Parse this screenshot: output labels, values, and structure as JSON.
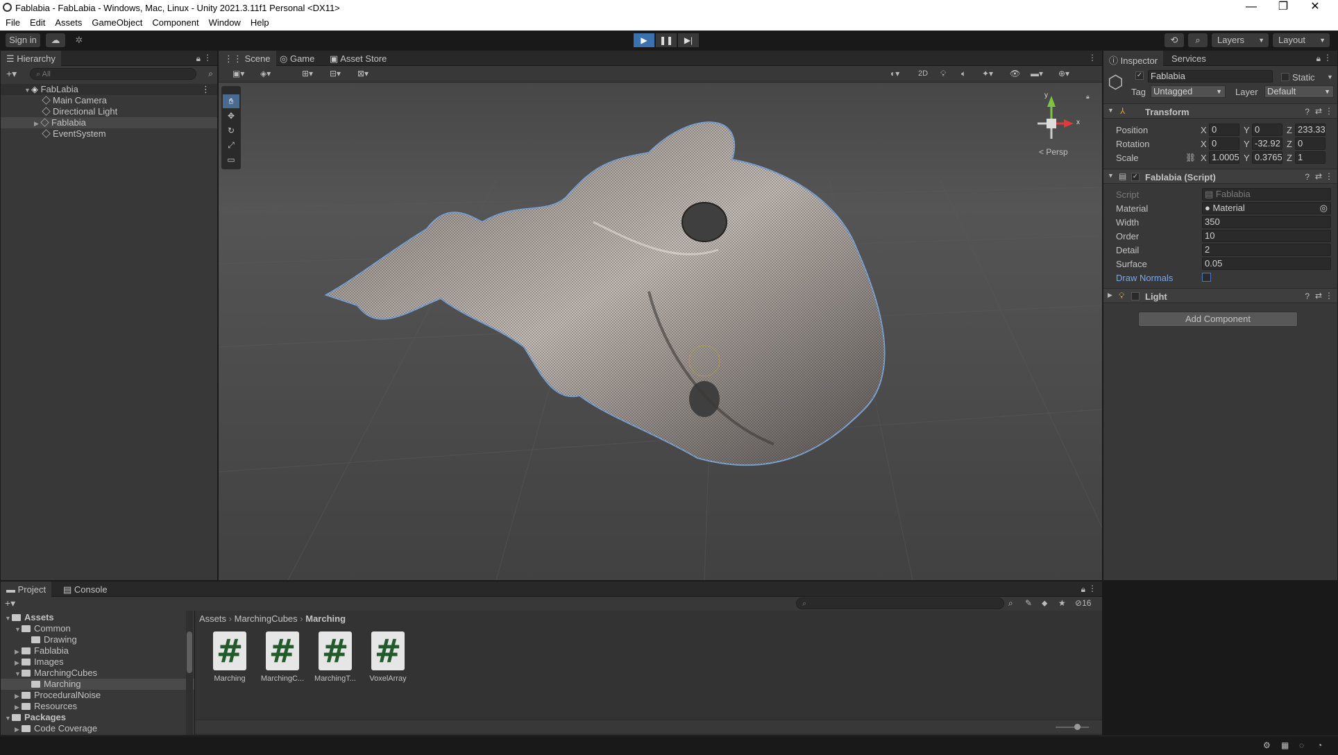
{
  "window": {
    "title": "Fablabia - FabLabia - Windows, Mac, Linux - Unity 2021.3.11f1 Personal <DX11>",
    "minimize": "—",
    "maximize": "❐",
    "close": "✕"
  },
  "menu": [
    "File",
    "Edit",
    "Assets",
    "GameObject",
    "Component",
    "Window",
    "Help"
  ],
  "toolbar": {
    "sign_in": "Sign in",
    "layers": "Layers",
    "layout": "Layout"
  },
  "hierarchy": {
    "tab": "Hierarchy",
    "search_placeholder": "All",
    "scene": "FabLabia",
    "items": [
      "Main Camera",
      "Directional Light",
      "Fablabia",
      "EventSystem"
    ]
  },
  "scene_view": {
    "tabs": [
      "Scene",
      "Game",
      "Asset Store"
    ],
    "mode_2d": "2D",
    "persp": "< Persp",
    "axis_y": "y",
    "axis_x": "x"
  },
  "inspector": {
    "tabs": [
      "Inspector",
      "Services"
    ],
    "object_name": "Fablabia",
    "static_label": "Static",
    "tag_label": "Tag",
    "tag_value": "Untagged",
    "layer_label": "Layer",
    "layer_value": "Default",
    "transform": {
      "title": "Transform",
      "position": {
        "label": "Position",
        "x": "0",
        "y": "0",
        "z": "233.33"
      },
      "rotation": {
        "label": "Rotation",
        "x": "0",
        "y": "-32.92",
        "z": "0"
      },
      "scale": {
        "label": "Scale",
        "x": "1.0005",
        "y": "0.3765",
        "z": "1"
      }
    },
    "script": {
      "title": "Fablabia (Script)",
      "fields": [
        {
          "label": "Script",
          "value": "Fablabia"
        },
        {
          "label": "Material",
          "value": "Material"
        },
        {
          "label": "Width",
          "value": "350"
        },
        {
          "label": "Order",
          "value": "10"
        },
        {
          "label": "Detail",
          "value": "2"
        },
        {
          "label": "Surface",
          "value": "0.05"
        }
      ],
      "draw_normals": "Draw Normals"
    },
    "light": {
      "title": "Light"
    },
    "add_component": "Add Component"
  },
  "project": {
    "tabs": [
      "Project",
      "Console"
    ],
    "tree": [
      {
        "label": "Assets",
        "depth": 0,
        "bold": true
      },
      {
        "label": "Common",
        "depth": 1
      },
      {
        "label": "Drawing",
        "depth": 2
      },
      {
        "label": "Fablabia",
        "depth": 1
      },
      {
        "label": "Images",
        "depth": 1
      },
      {
        "label": "MarchingCubes",
        "depth": 1
      },
      {
        "label": "Marching",
        "depth": 2,
        "selected": true
      },
      {
        "label": "ProceduralNoise",
        "depth": 1
      },
      {
        "label": "Resources",
        "depth": 1
      },
      {
        "label": "Packages",
        "depth": 0,
        "bold": true
      },
      {
        "label": "Code Coverage",
        "depth": 1
      }
    ],
    "breadcrumb": [
      "Assets",
      "MarchingCubes",
      "Marching"
    ],
    "files": [
      "Marching",
      "MarchingC...",
      "MarchingT...",
      "VoxelArray"
    ],
    "hidden_count": "16"
  },
  "colors": {
    "accent": "#3a72b0",
    "panel": "#383838",
    "dark": "#282828",
    "scene_bg": "#444444"
  }
}
